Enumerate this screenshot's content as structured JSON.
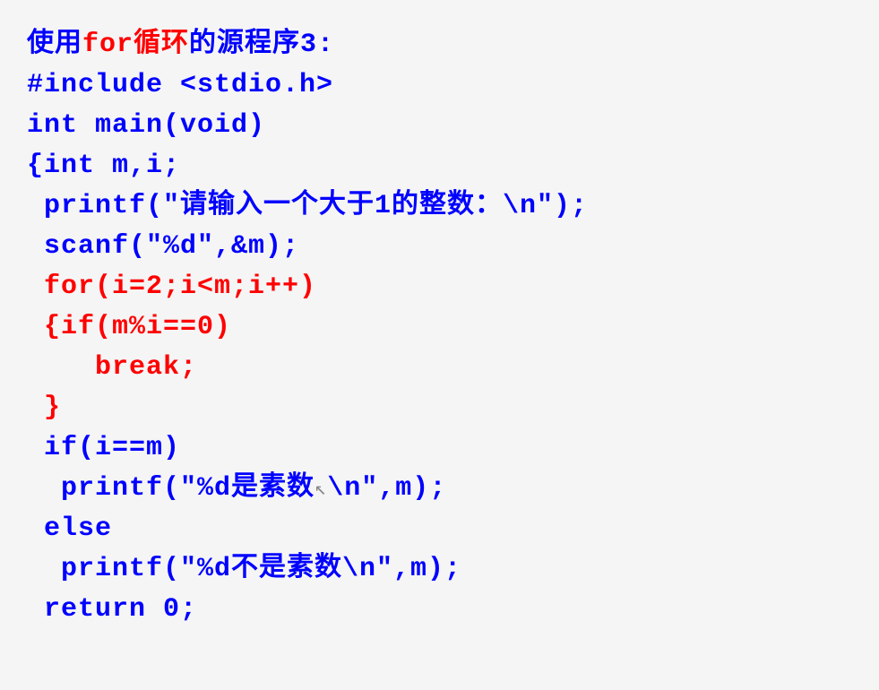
{
  "title": {
    "prefix": "使用",
    "highlight": "for循环",
    "suffix": "的源程序3:"
  },
  "code": {
    "line1": "#include <stdio.h>",
    "line2": "int main(void)",
    "line3": "{int m,i;",
    "line4": " printf(\"请输入一个大于1的整数：\\n\");",
    "line5": " scanf(\"%d\",&m);",
    "line6": " for(i=2;i<m;i++)",
    "line7": " {if(m%i==0)",
    "line8": "    break;",
    "line9": " }",
    "line10": " if(i==m)",
    "line11_a": "  printf(\"%d是素数",
    "line11_b": "\\n\",m);",
    "line12": " else",
    "line13": "  printf(\"%d不是素数\\n\",m);",
    "line14": " return 0;"
  }
}
